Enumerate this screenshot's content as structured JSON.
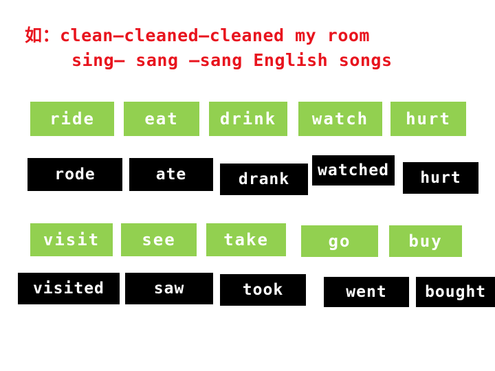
{
  "slide": {
    "example": {
      "line1": "如：clean—cleaned—cleaned my room",
      "line2": "sing— sang —sang English songs",
      "color": "#e8141e"
    },
    "colors": {
      "base_verb_background": "#92d050",
      "past_verb_background": "#000000",
      "text": "#ffffff",
      "slide_background": "#ffffff"
    },
    "groups": [
      {
        "base_verbs": [
          "ride",
          "eat",
          "drink",
          "watch",
          "hurt"
        ],
        "past_verbs": [
          "rode",
          "ate",
          "drank",
          "watched",
          "hurt"
        ]
      },
      {
        "base_verbs": [
          "visit",
          "see",
          "take",
          "go",
          "buy"
        ],
        "past_verbs": [
          "visited",
          "saw",
          "took",
          "went",
          "bought"
        ]
      }
    ]
  }
}
